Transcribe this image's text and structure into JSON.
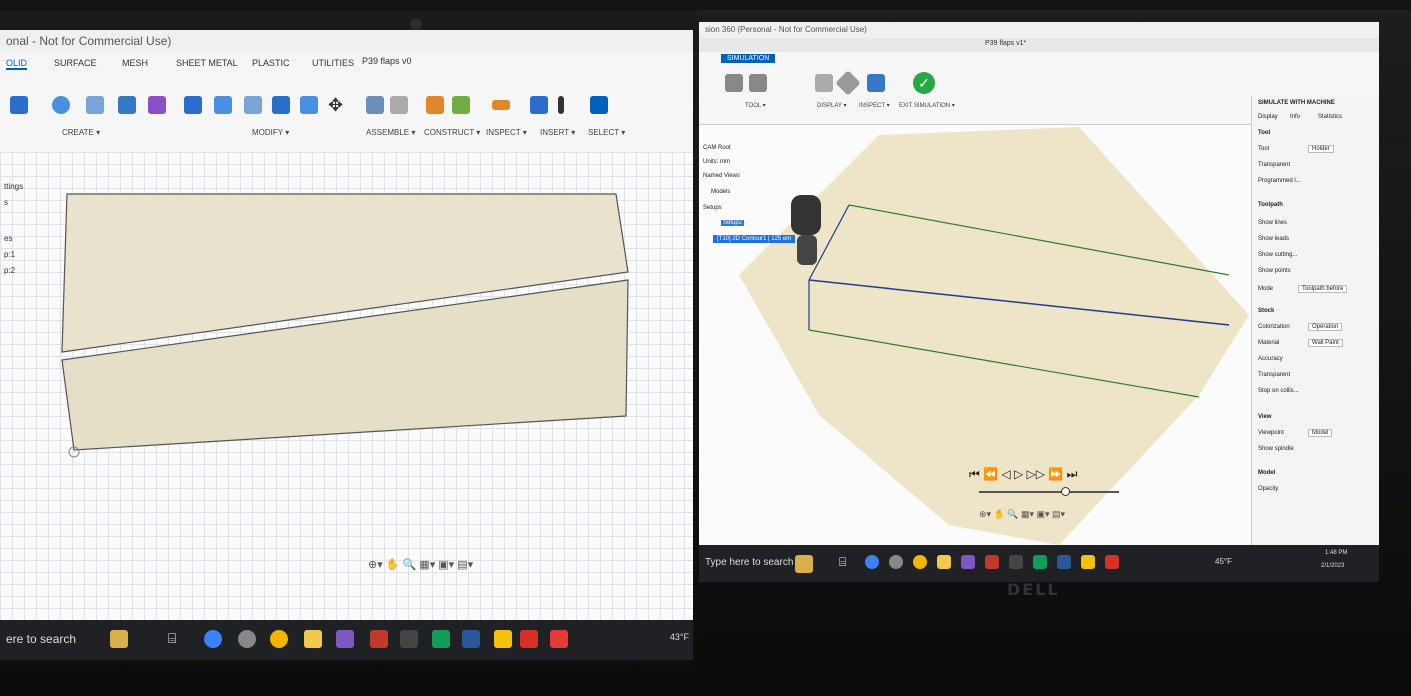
{
  "left": {
    "titlebar": "onal - Not for Commercial Use)",
    "doc_title": "P39 flaps v0",
    "tabs": [
      "OLID",
      "SURFACE",
      "MESH",
      "SHEET METAL",
      "PLASTIC",
      "UTILITIES"
    ],
    "groups": [
      "CREATE ▾",
      "MODIFY ▾",
      "ASSEMBLE ▾",
      "CONSTRUCT ▾",
      "INSPECT ▾",
      "INSERT ▾",
      "SELECT ▾"
    ],
    "browser": [
      "ttings",
      "s",
      "es",
      "p:1",
      "p:2"
    ],
    "taskbar_search": "ere to search",
    "temp": "43°F"
  },
  "right": {
    "titlebar": "sion 360 (Personal - Not for Commercial Use)",
    "doc_title": "P39 flaps v1*",
    "tab": "SIMULATION",
    "groups": [
      "TOOL ▾",
      "DISPLAY ▾",
      "INSPECT ▾",
      "EXIT SIMULATION ▾"
    ],
    "browser": [
      "CAM Root",
      "Units: mm",
      "Named Views",
      "Models",
      "Setups",
      "Setup2",
      "[T10] 2D Contour1 | 125 em"
    ],
    "panel_title": "SIMULATE WITH MACHINE",
    "panel_tabs": [
      "Display",
      "Info",
      "Statistics"
    ],
    "tool_section": "Tool",
    "tool_rows": [
      "Tool",
      "Transparent",
      "Programmed l..."
    ],
    "tool_value": "Holder",
    "toolpath_section": "Toolpath",
    "toolpath_rows": [
      "Show lines",
      "Show leads",
      "Show cutting...",
      "Show points",
      "Mode"
    ],
    "mode_value": "Toolpath before",
    "stock_section": "Stock",
    "stock_rows": [
      "Colorization",
      "Material",
      "Accuracy",
      "Transparent",
      "Stop on collis..."
    ],
    "colorization_value": "Operation",
    "material_value": "Wall Paint",
    "view_section": "View",
    "view_rows": [
      "Viewpoint",
      "Show spindle"
    ],
    "viewpoint_value": "Model",
    "model_section": "Model",
    "model_rows": [
      "Opacity"
    ],
    "taskbar_search": "Type here to search",
    "temp": "45°F",
    "time": "1:48 PM",
    "date": "2/1/2023",
    "dell": "DELL"
  },
  "colors": {
    "accent": "#0062b8",
    "part": "#e9e2cc",
    "check": "#28a745"
  }
}
